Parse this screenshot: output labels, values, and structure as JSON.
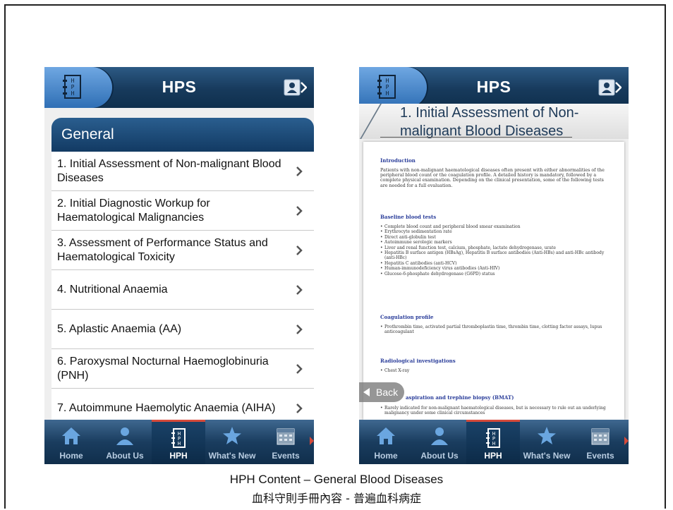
{
  "app": {
    "title": "HPS"
  },
  "left_screen": {
    "section_title": "General",
    "items": [
      {
        "label": "1. Initial Assessment of Non-malignant Blood Diseases"
      },
      {
        "label": "2. Initial Diagnostic Workup for Haematological Malignancies"
      },
      {
        "label": "3. Assessment of Performance Status and Haematological Toxicity"
      },
      {
        "label": "4. Nutritional Anaemia"
      },
      {
        "label": "5. Aplastic Anaemia (AA)"
      },
      {
        "label": "6. Paroxysmal Nocturnal Haemoglobinuria (PNH)"
      },
      {
        "label": "7. Autoimmune Haemolytic Anaemia (AIHA)"
      }
    ]
  },
  "right_screen": {
    "doc_title_line1": "1. Initial Assessment of Non-",
    "doc_title_line2": "malignant Blood Diseases",
    "back_label": "Back",
    "intro_heading": "Introduction",
    "intro_text": "Patients with non-malignant haematological diseases often present with either abnormalities of the peripheral blood count or the coagulation profile. A detailed history is mandatory, followed by a complete physical examination. Depending on the clinical presentation, some of the following tests are needed for a full evaluation.",
    "baseline_heading": "Baseline blood tests",
    "baseline_items": [
      "Complete blood count and peripheral blood smear examination",
      "Erythrocyte sedimentation rate",
      "Direct anti-globulin test",
      "Autoimmune serologic markers",
      "Liver and renal function test, calcium, phosphate, lactate dehydrogenase, urate",
      "Hepatitis B surface antigen (HBsAg), Hepatitis B surface antibodies (Anti-HBs) and anti-HBc antibody (anti-HBc)",
      "Hepatitis C antibodies (anti-HCV)",
      "Human-immunodeficiency virus antibodies (Anti-HIV)",
      "Glucose-6-phosphate dehydrogenase (G6PD) status"
    ],
    "coag_heading": "Coagulation profile",
    "coag_items": [
      "Prothrombin time, activated partial thromboplastin time, thrombin time, clotting factor assays, lupus anticoagulant"
    ],
    "radio_heading": "Radiological investigations",
    "radio_items": [
      "Chest X-ray"
    ],
    "bmat_heading": "aspiration and trephine biopsy (BMAT)",
    "bmat_items": [
      "Rarely indicated for non-malignant haematological diseases, but is necessary to rule out an underlying malignancy under some clinical circumstances"
    ]
  },
  "tabs": [
    {
      "label": "Home",
      "icon": "home-icon"
    },
    {
      "label": "About Us",
      "icon": "person-icon"
    },
    {
      "label": "HPH",
      "icon": "book-icon",
      "active": true
    },
    {
      "label": "What's New",
      "icon": "star-icon"
    },
    {
      "label": "Events",
      "icon": "calendar-icon"
    }
  ],
  "captions": {
    "line1": "HPH Content – General Blood Diseases",
    "line2": "血科守則手冊內容 - 普遍血科病症"
  },
  "colors": {
    "navy": "#173a5c",
    "accent_blue": "#4a8fd6",
    "tab_active_marker": "#d64a3a"
  }
}
